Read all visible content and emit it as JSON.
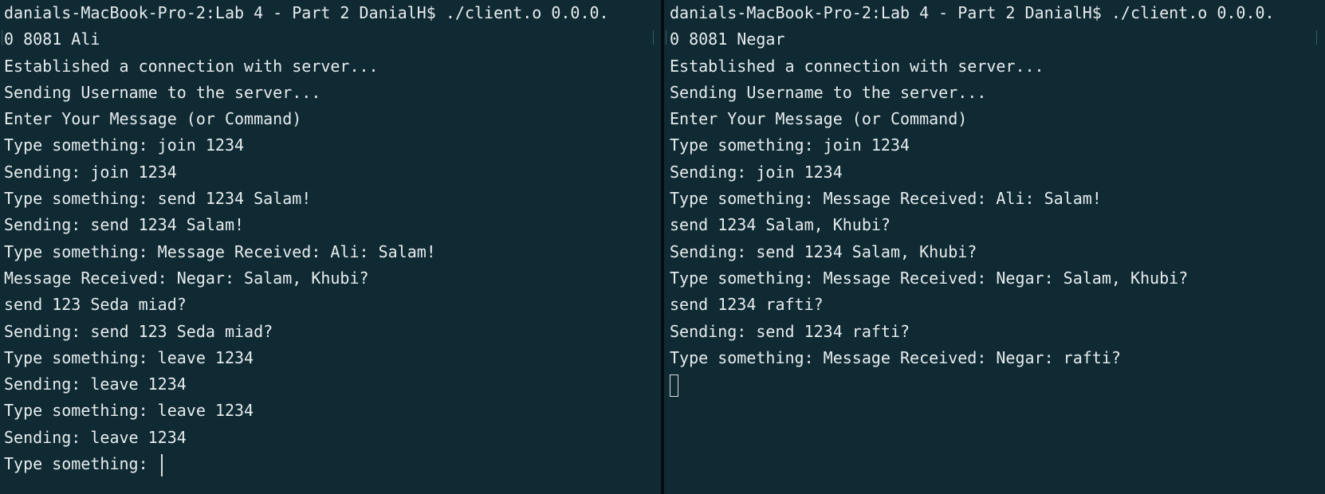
{
  "terminals": [
    {
      "name": "left",
      "lines": [
        "danials-MacBook-Pro-2:Lab 4 - Part 2 DanialH$ ./client.o 0.0.0.",
        "0 8081 Ali",
        "Established a connection with server...",
        "Sending Username to the server...",
        "Enter Your Message (or Command)",
        "Type something: join 1234",
        "Sending: join 1234",
        "Type something: send 1234 Salam!",
        "Sending: send 1234 Salam!",
        "Type something: Message Received: Ali: Salam!",
        "Message Received: Negar: Salam, Khubi?",
        "send 123 Seda miad?",
        "Sending: send 123 Seda miad?",
        "Type something: leave 1234",
        "Sending: leave 1234",
        "Type something: leave 1234",
        "Sending: leave 1234",
        "Type something: "
      ]
    },
    {
      "name": "right",
      "lines": [
        "danials-MacBook-Pro-2:Lab 4 - Part 2 DanialH$ ./client.o 0.0.0.",
        "0 8081 Negar",
        "Established a connection with server...",
        "Sending Username to the server...",
        "Enter Your Message (or Command)",
        "Type something: join 1234",
        "Sending: join 1234",
        "Type something: Message Received: Ali: Salam!",
        "send 1234 Salam, Khubi?",
        "Sending: send 1234 Salam, Khubi?",
        "Type something: Message Received: Negar: Salam, Khubi?",
        "send 1234 rafti?",
        "Sending: send 1234 rafti?",
        "Type something: Message Received: Negar: rafti?",
        ""
      ]
    }
  ],
  "colors": {
    "background": "#0f2a33",
    "text": "#e7ecee",
    "divider": "#050d11"
  }
}
